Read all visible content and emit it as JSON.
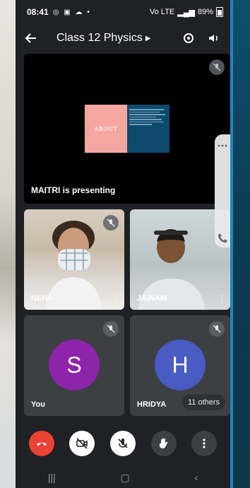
{
  "status_bar": {
    "time": "08:41",
    "notification_icons": "◎ ▣ ☁ •",
    "signal_text": "Vo LTE",
    "battery": "89%"
  },
  "meeting": {
    "title": "Class 12 Physics"
  },
  "presentation": {
    "label": "MAITRI is presenting",
    "slide_heading": "ABOUT"
  },
  "participants": [
    {
      "name": "NEHA",
      "muted": true
    },
    {
      "name": "JAINAM",
      "muted": false
    },
    {
      "name": "You",
      "muted": true,
      "avatar_letter": "S",
      "avatar_color": "#8e24aa"
    },
    {
      "name": "HRIDYA",
      "muted": true,
      "avatar_letter": "H",
      "avatar_color": "#4a5bc4"
    }
  ],
  "others_chip": "11 others",
  "colors": {
    "end_call": "#ea4335",
    "background": "#202124",
    "tile": "#3c4043"
  },
  "controls": [
    "end-call",
    "camera-off",
    "mic-off",
    "raise-hand",
    "more-options"
  ]
}
